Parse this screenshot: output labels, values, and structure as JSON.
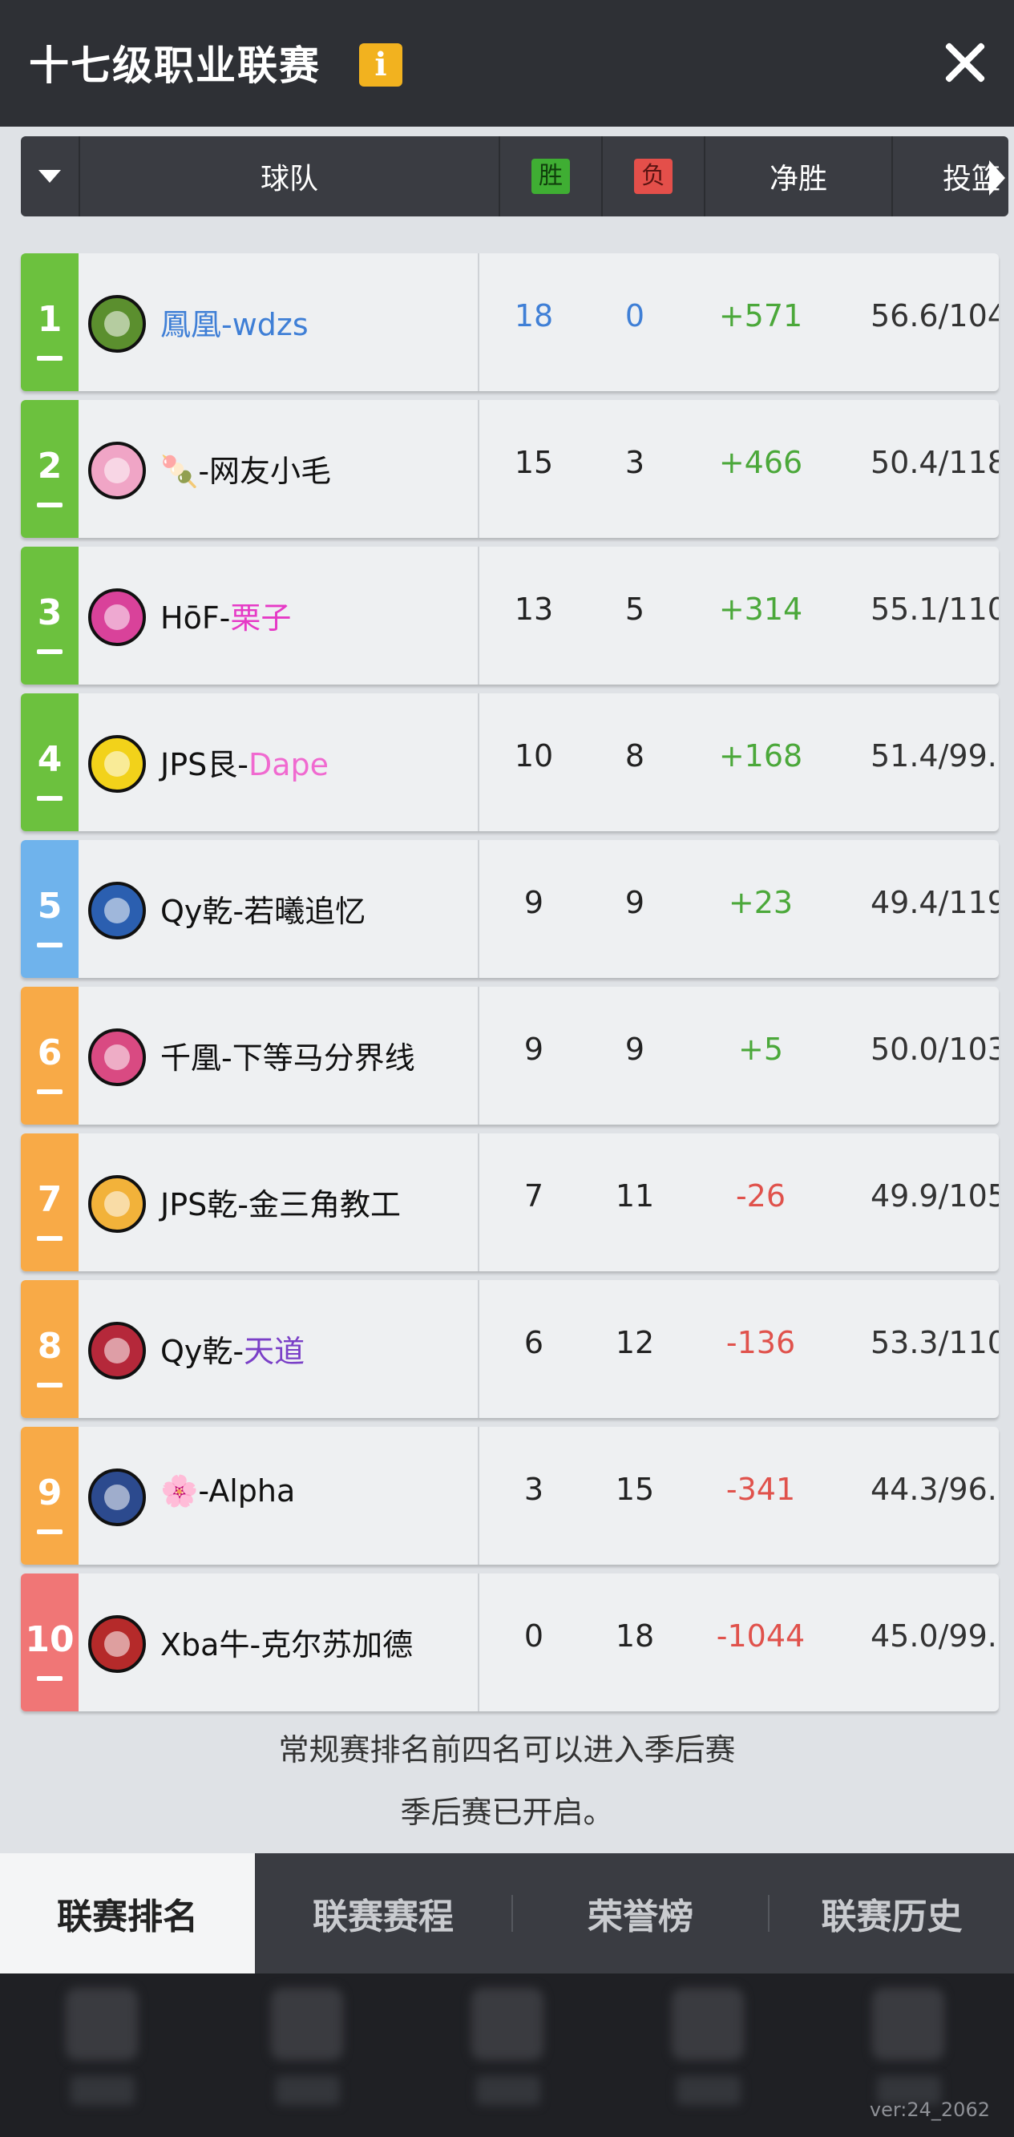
{
  "title": "十七级职业联赛",
  "header": {
    "team_label": "球队",
    "win_label": "胜",
    "loss_label": "负",
    "net_label": "净胜",
    "shooting_label": "投篮"
  },
  "colors": {
    "green": "#6cc13e",
    "blue": "#6fb3ec",
    "orange": "#f8aa47",
    "red": "#f07676",
    "positive": "#4ba83a",
    "negative": "#e0524c",
    "link_blue": "#3f7fd6",
    "pink": "#e63ac6",
    "light_pink": "#f06ad0",
    "purple": "#7a3fc7"
  },
  "teams": [
    {
      "rank": "1",
      "pre": "",
      "name": "鳳凰-wdzs",
      "wins": "18",
      "losses": "0",
      "net": "+571",
      "shooting": "56.6/104"
    },
    {
      "rank": "2",
      "pre": "🍡",
      "name": "-网友小毛",
      "wins": "15",
      "losses": "3",
      "net": "+466",
      "shooting": "50.4/118"
    },
    {
      "rank": "3",
      "pre": "HōF-",
      "name": "栗子",
      "wins": "13",
      "losses": "5",
      "net": "+314",
      "shooting": "55.1/110"
    },
    {
      "rank": "4",
      "pre": "JPS艮-",
      "name": "Dape",
      "wins": "10",
      "losses": "8",
      "net": "+168",
      "shooting": "51.4/99."
    },
    {
      "rank": "5",
      "pre": "",
      "name": "Qy乾-若曦追忆",
      "wins": "9",
      "losses": "9",
      "net": "+23",
      "shooting": "49.4/119"
    },
    {
      "rank": "6",
      "pre": "",
      "name": "千凰-下等马分界线",
      "wins": "9",
      "losses": "9",
      "net": "+5",
      "shooting": "50.0/103"
    },
    {
      "rank": "7",
      "pre": "",
      "name": "JPS乾-金三角教工",
      "wins": "7",
      "losses": "11",
      "net": "-26",
      "shooting": "49.9/105"
    },
    {
      "rank": "8",
      "pre": "Qy乾-",
      "name": "天道",
      "wins": "6",
      "losses": "12",
      "net": "-136",
      "shooting": "53.3/110"
    },
    {
      "rank": "9",
      "pre": "🌸",
      "name": "-Alpha",
      "wins": "3",
      "losses": "15",
      "net": "-341",
      "shooting": "44.3/96."
    },
    {
      "rank": "10",
      "pre": "",
      "name": "Xba牛-克尔苏加德",
      "wins": "0",
      "losses": "18",
      "net": "-1044",
      "shooting": "45.0/99."
    }
  ],
  "notes": {
    "line1": "常规赛排名前四名可以进入季后赛",
    "line2": "季后赛已开启。"
  },
  "tabs": [
    "联赛排名",
    "联赛赛程",
    "荣誉榜",
    "联赛历史"
  ],
  "version": "ver:24_2062"
}
